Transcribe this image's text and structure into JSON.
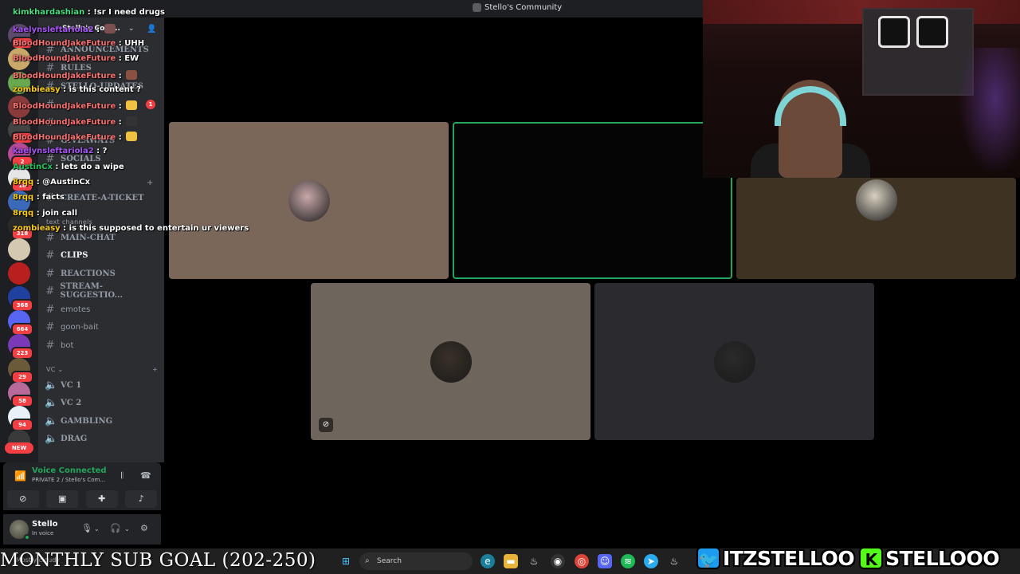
{
  "window": {
    "title": "Stello's Community"
  },
  "servers": [
    {
      "badge": "24",
      "color": "#5b4a6b"
    },
    {
      "badge": "",
      "color": "#caa86a"
    },
    {
      "badge": "",
      "color": "#6aa84f"
    },
    {
      "badge": "",
      "color": "#8a3a3a"
    },
    {
      "badge": "1",
      "color": "#444"
    },
    {
      "badge": "2",
      "color": "#b84a9a"
    },
    {
      "badge": "18",
      "color": "#e6e6e6"
    },
    {
      "badge": "",
      "color": "#3a6ab8"
    },
    {
      "badge": "318",
      "color": "#2a2a2a"
    },
    {
      "badge": "",
      "color": "#d4c8b0"
    },
    {
      "badge": "",
      "color": "#b82020"
    },
    {
      "badge": "368",
      "color": "#2040a0"
    },
    {
      "badge": "664",
      "color": "#5865f2"
    },
    {
      "badge": "223",
      "color": "#7a3ab8"
    },
    {
      "badge": "29",
      "color": "#6a5a3a"
    },
    {
      "badge": "58",
      "color": "#b86a9a"
    },
    {
      "badge": "94",
      "color": "#e8f0f8"
    },
    {
      "badge": "",
      "color": "#3a3a3a"
    }
  ],
  "new_badge": "NEW",
  "channel_list": {
    "server_name": "Stello's Com...",
    "channels": [
      {
        "name": "ANNOUNCEMENTS",
        "style": "upper"
      },
      {
        "name": "RULES",
        "style": "upper"
      },
      {
        "name": "STELLO-UPDATES",
        "style": "upper"
      },
      {
        "name": "",
        "style": "upper"
      },
      {
        "name": "",
        "style": "upper"
      },
      {
        "name": "GIVEAWAYS",
        "style": "upper"
      },
      {
        "name": "SOCIALS",
        "style": "upper"
      },
      {
        "name": "CREATE-A-TICKET",
        "style": "upper"
      }
    ],
    "text_category": "text channels",
    "text_channels": [
      {
        "name": "MAIN-CHAT",
        "style": "upper",
        "active": false
      },
      {
        "name": "CLIPS",
        "style": "upper",
        "active": true
      },
      {
        "name": "REACTIONS",
        "style": "upper",
        "active": false
      },
      {
        "name": "STREAM-SUGGESTIO...",
        "style": "upper",
        "active": false
      },
      {
        "name": "emotes",
        "style": "lower",
        "active": false
      },
      {
        "name": "goon-bait",
        "style": "lower",
        "active": false
      },
      {
        "name": "bot",
        "style": "lower",
        "active": false
      }
    ],
    "vc_category": "VC",
    "voice_channels": [
      "VC 1",
      "VC 2",
      "GAMBLING",
      "DRAG"
    ],
    "mention_badge": "1"
  },
  "voice_panel": {
    "status": "Voice Connected",
    "channel": "PRIVATE 2 / Stello's Com..."
  },
  "user_panel": {
    "name": "Stello",
    "status": "In voice"
  },
  "chat": [
    {
      "user": "kimkhardashian",
      "color": "#4ade80",
      "text": " : !sr I need drugs"
    },
    {
      "user": "kaelynsleftariola2",
      "color": "#a855f7",
      "text": " : "
    },
    {
      "user": "BloodHoundJakeFuture",
      "color": "#f87171",
      "text": " : UHH"
    },
    {
      "user": "BloodHoundJakeFuture",
      "color": "#f87171",
      "text": " : EW"
    },
    {
      "user": "BloodHoundJakeFuture",
      "color": "#f87171",
      "text": " : "
    },
    {
      "user": "zombieasy",
      "color": "#facc15",
      "text": " : is this content ?"
    },
    {
      "user": "BloodHoundJakeFuture",
      "color": "#f87171",
      "text": " : "
    },
    {
      "user": "BloodHoundJakeFuture",
      "color": "#f87171",
      "text": " : "
    },
    {
      "user": "BloodHoundJakeFuture",
      "color": "#f87171",
      "text": " : "
    },
    {
      "user": "kaelynsleftariola2",
      "color": "#a855f7",
      "text": " : ?"
    },
    {
      "user": "AustinCx",
      "color": "#22c55e",
      "text": " : lets do a wipe"
    },
    {
      "user": "8rqq",
      "color": "#facc15",
      "text": " : @AustinCx"
    },
    {
      "user": "8rqq",
      "color": "#facc15",
      "text": " : facts"
    },
    {
      "user": "8rqq",
      "color": "#facc15",
      "text": " : join call"
    },
    {
      "user": "zombieasy",
      "color": "#facc15",
      "text": " : is this supposed to entertain ur viewers"
    }
  ],
  "tiles": [
    {
      "bg": "#7a675a",
      "avatar": "#c8a8a8"
    },
    {
      "bg": "#050505",
      "avatar": ""
    },
    {
      "bg": "#3e3322",
      "avatar": "#d8d0c0"
    },
    {
      "bg": "#6e655c",
      "avatar": "#3a3028"
    },
    {
      "bg": "#2b2a2e",
      "avatar": "#2a2a2a"
    }
  ],
  "taskbar": {
    "search_placeholder": "Search",
    "weather": "Mostly cloudy"
  },
  "overlay": {
    "sub_goal": "MONTHLY SUB GOAL (202-250)",
    "twitter": "ITZSTELLOO",
    "kick": "STELLOOO"
  },
  "colors": {
    "speaking_outline": "#23a55a",
    "discord_bg": "#2b2d31",
    "rail_bg": "#1e1f22",
    "twitter": "#1d9bf0",
    "kick": "#53fc18"
  }
}
